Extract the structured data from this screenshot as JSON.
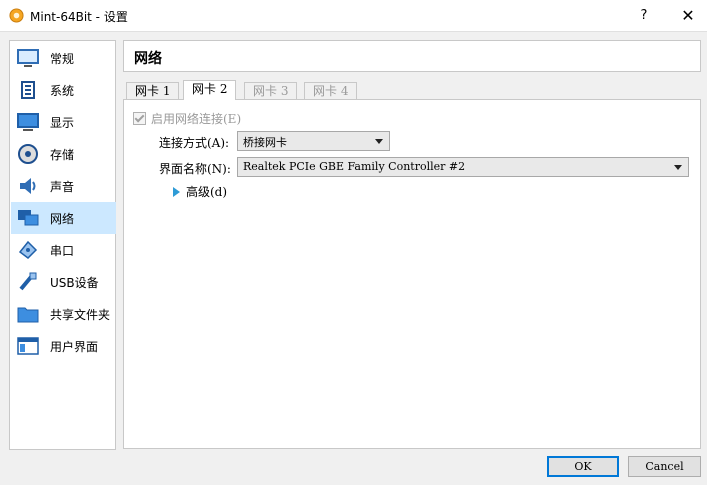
{
  "window": {
    "title": "Mint-64Bit - 设置",
    "help_label": "?",
    "close_label": "✕"
  },
  "sidebar": {
    "items": [
      {
        "label": "常规",
        "icon": "general-icon"
      },
      {
        "label": "系统",
        "icon": "system-icon"
      },
      {
        "label": "显示",
        "icon": "display-icon"
      },
      {
        "label": "存储",
        "icon": "storage-icon"
      },
      {
        "label": "声音",
        "icon": "audio-icon"
      },
      {
        "label": "网络",
        "icon": "network-icon",
        "selected": true
      },
      {
        "label": "串口",
        "icon": "serial-port-icon"
      },
      {
        "label": "USB设备",
        "icon": "usb-icon"
      },
      {
        "label": "共享文件夹",
        "icon": "shared-folder-icon"
      },
      {
        "label": "用户界面",
        "icon": "user-interface-icon"
      }
    ]
  },
  "header": {
    "title": "网络"
  },
  "tabs": [
    {
      "label": "网卡 1",
      "state": "normal"
    },
    {
      "label": "网卡 2",
      "state": "active"
    },
    {
      "label": "网卡 3",
      "state": "disabled"
    },
    {
      "label": "网卡 4",
      "state": "disabled"
    }
  ],
  "panel": {
    "enable_label": "启用网络连接(E)",
    "enable_checked": true,
    "attached_label": "连接方式(A):",
    "attached_value": "桥接网卡",
    "name_label": "界面名称(N):",
    "name_value": "Realtek PCIe GBE Family Controller #2",
    "advanced_label": "高级(d)"
  },
  "buttons": {
    "ok": "OK",
    "cancel": "Cancel"
  },
  "colors": {
    "selection": "#cce8ff",
    "accent": "#0078d7",
    "arrow": "#2e9bd6"
  }
}
